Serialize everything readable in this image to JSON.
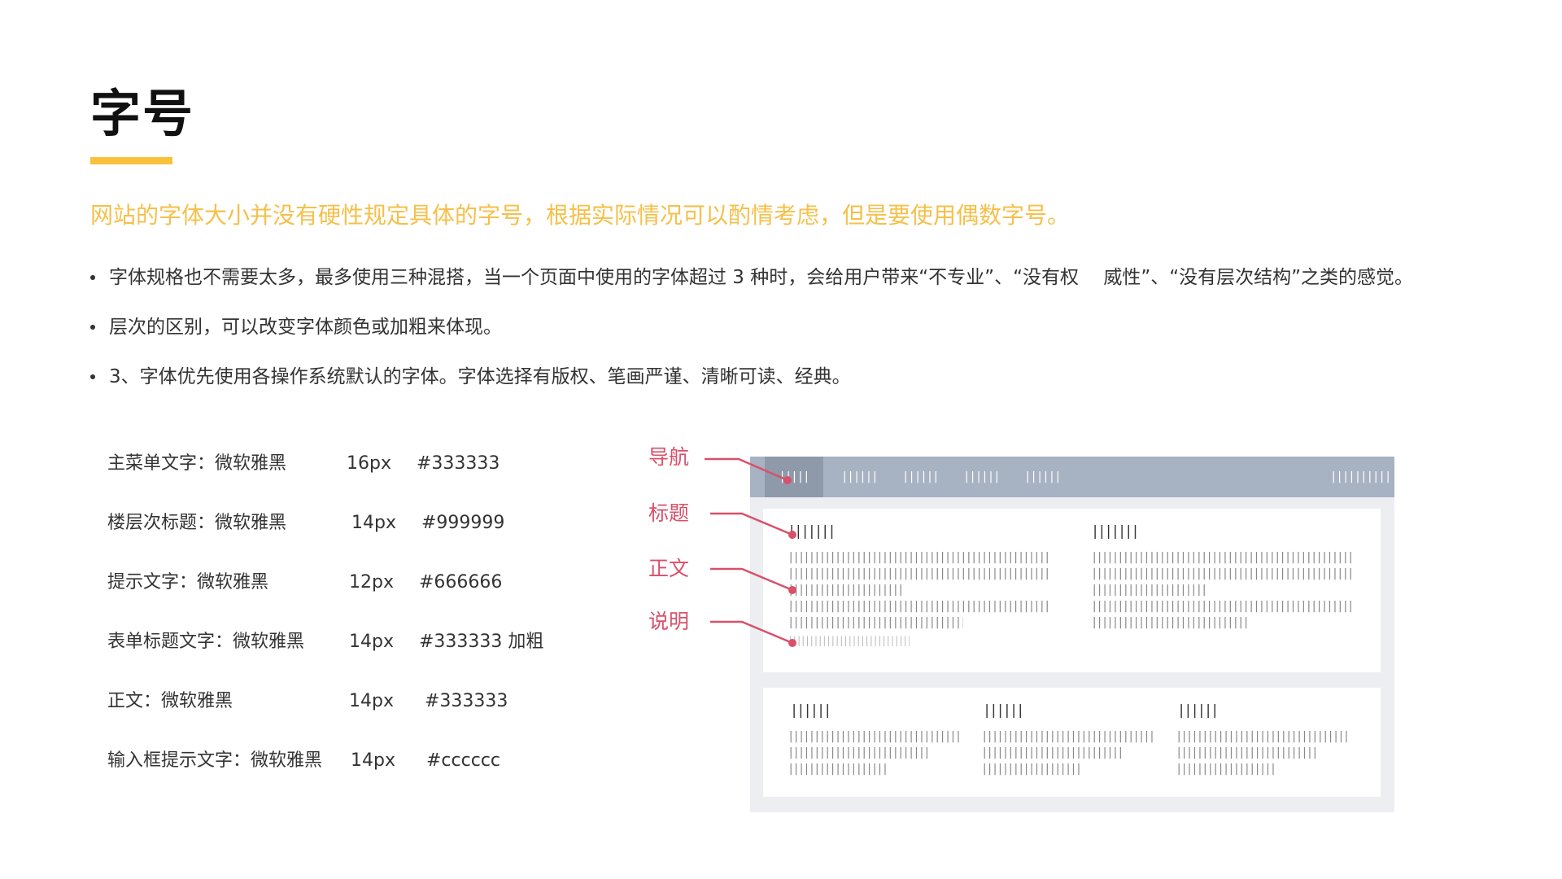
{
  "title": "字号",
  "subtitle": "网站的字体大小并没有硬性规定具体的字号，根据实际情况可以酌情考虑，但是要使用偶数字号。",
  "bullets": [
    "字体规格也不需要太多，最多使用三种混搭，当一个页面中使用的字体超过 3 种时，会给用户带来“不专业”、“没有权　 威性”、“没有层次结构”之类的感觉。",
    "层次的区别，可以改变字体颜色或加粗来体现。",
    "3、字体优先使用各操作系统默认的字体。字体选择有版权、笔画严谨、清晰可读、经典。"
  ],
  "specs": [
    {
      "label": "主菜单文字：微软雅黑",
      "size": "16px",
      "color": "#333333"
    },
    {
      "label": "楼层次标题：微软雅黑",
      "size": "14px",
      "color": "#999999"
    },
    {
      "label": "提示文字：微软雅黑",
      "size": "12px",
      "color": "#666666"
    },
    {
      "label": "表单标题文字：微软雅黑",
      "size": "14px",
      "color": "#333333 加粗"
    },
    {
      "label": "正文：微软雅黑",
      "size": "14px",
      "color": "#333333"
    },
    {
      "label": "输入框提示文字：微软雅黑",
      "size": "14px",
      "color": "#cccccc"
    }
  ],
  "callouts": {
    "nav": "导航",
    "heading": "标题",
    "body": "正文",
    "note": "说明"
  },
  "mock": {
    "nav_items": [
      "|||||",
      "||||||",
      "||||||",
      "||||||",
      "||||||"
    ],
    "nav_right": "||||||||||",
    "card_heading": "||||||||",
    "body_line": "||||||||||||||||||||||||||||||||||||||||||||||||||||||||||||||||||||",
    "body_short": "||||||||||||||||||||||||||||||",
    "body_mid": "||||||||||||||||||||||||||||||||||||||||||||||",
    "note_line": "||||||||||||||||||||||||||||||||||||||||||||||",
    "small_heading": "|||||||",
    "small_line1": "||||||||||||||||||||||||||||||||||||||||||||||",
    "small_line2": "||||||||||||||||||||||||||||||||||||||",
    "small_line3": "|||||||||||||||||||||||||||"
  },
  "colors": {
    "accent": "#f7c23a",
    "subtitle": "#f5c04a",
    "callout": "#d9506a",
    "nav_bg": "#a7b2c2",
    "mock_bg": "#eceef2"
  }
}
